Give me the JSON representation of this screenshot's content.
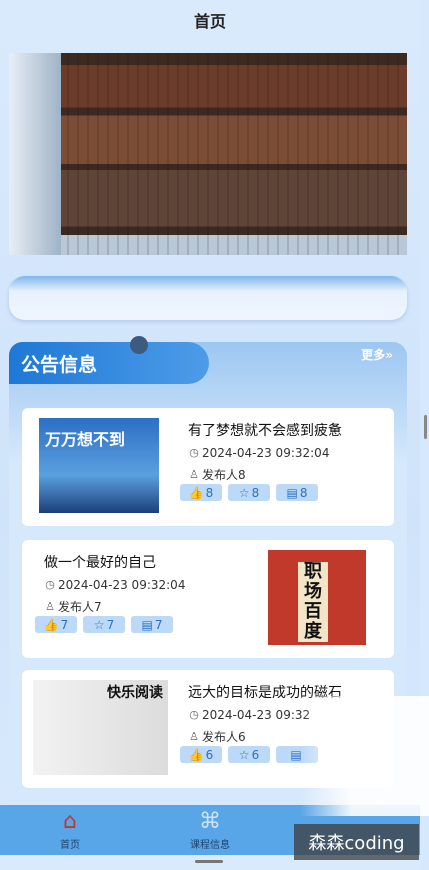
{
  "header": {
    "title": "首页"
  },
  "notice": {
    "title": "公告信息",
    "more": "更多»"
  },
  "items": [
    {
      "title": "有了梦想就不会感到疲惫",
      "time": "2024-04-23 09:32:04",
      "publisher": "发布人8",
      "likes": "8",
      "favorites": "8",
      "comments": "8",
      "cover_text": "万万想不到"
    },
    {
      "title": "做一个最好的自己",
      "time": "2024-04-23 09:32:04",
      "publisher": "发布人7",
      "likes": "7",
      "favorites": "7",
      "comments": "7",
      "cover_text": "职场百度"
    },
    {
      "title": "远大的目标是成功的磁石",
      "time": "2024-04-23 09:32",
      "publisher": "发布人6",
      "likes": "6",
      "favorites": "6",
      "comments": "",
      "cover_text": "快乐阅读"
    }
  ],
  "tabbar": [
    {
      "label": "首页",
      "icon": "home-icon"
    },
    {
      "label": "课程信息",
      "icon": "grid-icon"
    }
  ],
  "watermark": "森森coding",
  "colors": {
    "accent": "#1f78d6",
    "tabbar": "#58a5e7",
    "chip": "#bcd9f7"
  }
}
